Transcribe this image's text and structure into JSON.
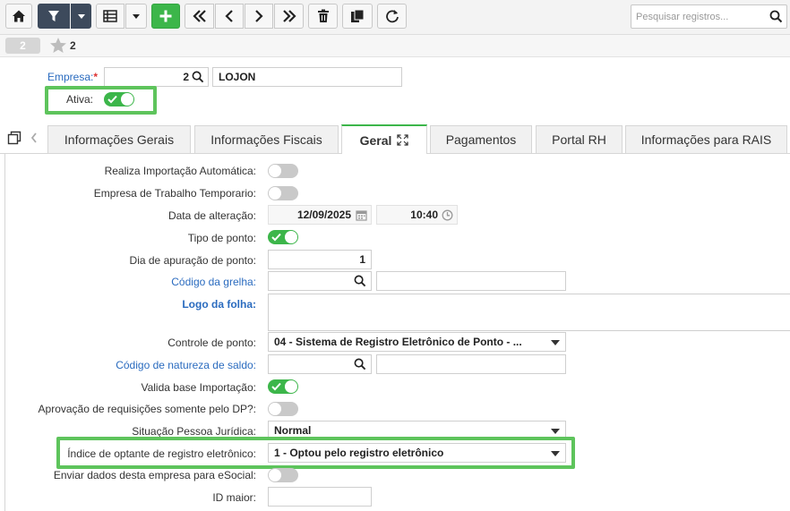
{
  "toolbar": {
    "search_placeholder": "Pesquisar registros..."
  },
  "subbar": {
    "record_badge": "2",
    "favorites_count": "2"
  },
  "header": {
    "empresa_label": "Empresa:",
    "required_mark": "*",
    "empresa_code": "2",
    "empresa_name": "LOJON",
    "ativa_label": "Ativa:",
    "ativa": true
  },
  "tabs": [
    {
      "label": "Informações Gerais",
      "active": false
    },
    {
      "label": "Informações Fiscais",
      "active": false
    },
    {
      "label": "Geral",
      "active": true
    },
    {
      "label": "Pagamentos",
      "active": false
    },
    {
      "label": "Portal RH",
      "active": false
    },
    {
      "label": "Informações para RAIS",
      "active": false
    }
  ],
  "form": {
    "importacao_automatica": {
      "label": "Realiza Importação Automática:",
      "value": false
    },
    "trabalho_temporario": {
      "label": "Empresa de Trabalho Temporario:",
      "value": false
    },
    "data_alteracao": {
      "label": "Data de alteração:",
      "date": "12/09/2025",
      "time": "10:40"
    },
    "tipo_ponto": {
      "label": "Tipo de ponto:",
      "value": true
    },
    "dia_apuracao": {
      "label": "Dia de apuração de ponto:",
      "value": "1"
    },
    "codigo_grelha": {
      "label": "Código da grelha:",
      "code": "",
      "desc": ""
    },
    "logo_folha": {
      "label": "Logo da folha:"
    },
    "controle_ponto": {
      "label": "Controle de ponto:",
      "value": "04 - Sistema de Registro Eletrônico de Ponto - ..."
    },
    "natureza_saldo": {
      "label": "Código de natureza de saldo:",
      "code": "",
      "desc": ""
    },
    "valida_base": {
      "label": "Valida base Importação:",
      "value": true
    },
    "aprovacao_dp": {
      "label": "Aprovação de requisições somente pelo DP?:",
      "value": false
    },
    "situacao_pj": {
      "label": "Situação Pessoa Jurídica:",
      "value": "Normal"
    },
    "indice_optante": {
      "label": "Índice de optante de registro eletrônico:",
      "value": "1 - Optou pelo registro eletrônico"
    },
    "enviar_esocial": {
      "label": "Enviar dados desta empresa para eSocial:",
      "value": false
    },
    "id_maior": {
      "label": "ID maior:",
      "value": ""
    }
  },
  "colors": {
    "accent_green": "#3cb64a",
    "highlight_green": "#5ec45c",
    "toolbar_dark": "#3d4a5c",
    "link_blue": "#2a6bbf"
  }
}
